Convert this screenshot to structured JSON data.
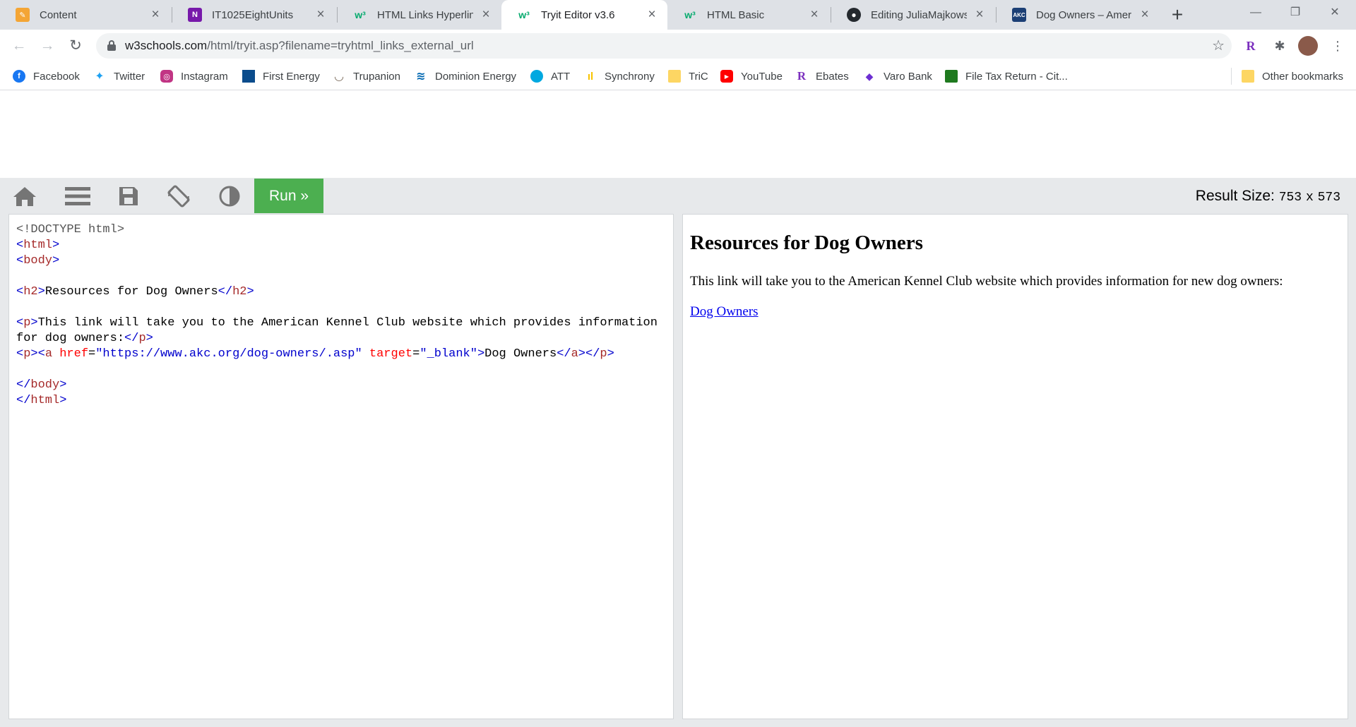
{
  "tabs": [
    {
      "title": "Content",
      "icon": "content-icon",
      "color": "#f4a535",
      "glyph": "✎"
    },
    {
      "title": "IT1025EightUnits",
      "icon": "onenote-icon",
      "color": "#7719aa",
      "glyph": "N"
    },
    {
      "title": "HTML Links Hyperlinks",
      "icon": "w3schools-icon",
      "color": "#04aa6d",
      "glyph": "w³"
    },
    {
      "title": "Tryit Editor v3.6",
      "icon": "w3schools-icon",
      "color": "#04aa6d",
      "glyph": "w³",
      "active": true
    },
    {
      "title": "HTML Basic",
      "icon": "w3schools-icon",
      "color": "#04aa6d",
      "glyph": "w³"
    },
    {
      "title": "Editing JuliaMajkowski/",
      "icon": "github-icon",
      "color": "#24292e",
      "glyph": "●"
    },
    {
      "title": "Dog Owners – American",
      "icon": "akc-icon",
      "color": "#1c3f75",
      "glyph": "AKC"
    }
  ],
  "tab_close_symbol": "×",
  "new_tab_symbol": "+",
  "window_controls": {
    "minimize": "—",
    "maximize": "❐",
    "close": "✕"
  },
  "address": {
    "host": "w3schools.com",
    "path": "/html/tryit.asp?filename=tryhtml_links_external_url"
  },
  "bookmarks": [
    {
      "label": "Facebook",
      "icon": "facebook-icon",
      "color": "#1877f2",
      "glyph": "f"
    },
    {
      "label": "Twitter",
      "icon": "twitter-icon",
      "color": "#1da1f2",
      "glyph": "t"
    },
    {
      "label": "Instagram",
      "icon": "instagram-icon",
      "color": "#c13584",
      "glyph": "◎"
    },
    {
      "label": "First Energy",
      "icon": "first-energy-icon",
      "color": "#0b4c8c",
      "glyph": "▰"
    },
    {
      "label": "Trupanion",
      "icon": "trupanion-icon",
      "color": "#7a6a5a",
      "glyph": "◡"
    },
    {
      "label": "Dominion Energy",
      "icon": "dominion-energy-icon",
      "color": "#0067b1",
      "glyph": "≋"
    },
    {
      "label": "ATT",
      "icon": "att-icon",
      "color": "#00a8e0",
      "glyph": "◍"
    },
    {
      "label": "Synchrony",
      "icon": "synchrony-icon",
      "color": "#f8c300",
      "glyph": "ıl"
    },
    {
      "label": "TriC",
      "icon": "folder-icon",
      "color": "#fdd663",
      "glyph": ""
    },
    {
      "label": "YouTube",
      "icon": "youtube-icon",
      "color": "#ff0000",
      "glyph": "▶"
    },
    {
      "label": "Ebates",
      "icon": "ebates-icon",
      "color": "#7b2fbe",
      "glyph": "R"
    },
    {
      "label": "Varo Bank",
      "icon": "varo-icon",
      "color": "#6d2fd2",
      "glyph": "◆"
    },
    {
      "label": "File Tax Return - Cit...",
      "icon": "tax-icon",
      "color": "#1f7a1f",
      "glyph": "▣"
    }
  ],
  "other_bookmarks": "Other bookmarks",
  "tryit": {
    "run_label": "Run »",
    "result_size_label": "Result Size:",
    "result_width": "753",
    "result_x": "x",
    "result_height": "573"
  },
  "code_lines": [
    "<!DOCTYPE html>",
    "<html>",
    "<body>",
    "",
    "<h2>Resources for Dog Owners</h2>",
    "",
    "<p>This link will take you to the American Kennel Club website which provides information",
    "for dog owners:</p>",
    "<p><a href=\"https://www.akc.org/dog-owners/.asp\" target=\"_blank\">Dog Owners</a></p>",
    "",
    "</body>",
    "</html>"
  ],
  "result": {
    "heading": "Resources for Dog Owners",
    "paragraph": "This link will take you to the American Kennel Club website which provides information for new dog owners:",
    "link_text": "Dog Owners"
  },
  "colors": {
    "run_button": "#4caf50",
    "tryit_toolbar": "#e7e9eb",
    "link": "#0000ee"
  }
}
